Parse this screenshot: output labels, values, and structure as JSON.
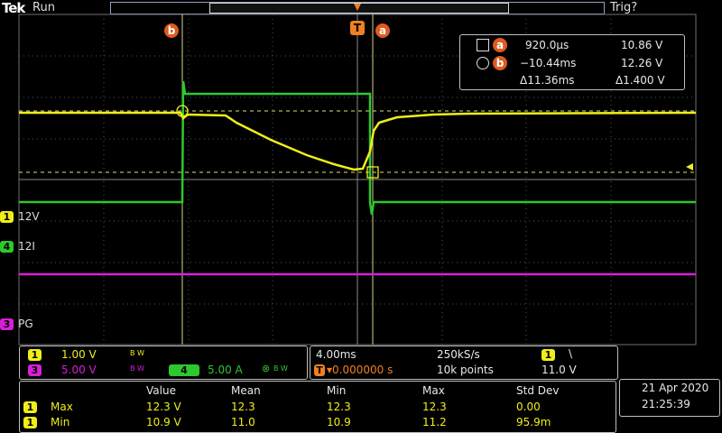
{
  "brand": "Tek",
  "run_state": "Run",
  "trigger_status": "Trig?",
  "markers": {
    "cursor_b": "b",
    "cursor_a": "a",
    "trigger": "T"
  },
  "cursor_readout": {
    "a_time": "920.0µs",
    "a_volt": "10.86 V",
    "b_time": "−10.44ms",
    "b_volt": "12.26 V",
    "delta_time": "Δ11.36ms",
    "delta_volt": "Δ1.400 V",
    "a_label": "a",
    "b_label": "b"
  },
  "channels": [
    {
      "num": "1",
      "name": "12V",
      "scale": "1.00 V",
      "bw": "B W",
      "color": "#f0ee1a"
    },
    {
      "num": "4",
      "name": "12I",
      "scale": "5.00 A",
      "bw": "B W",
      "color": "#2ec82e"
    },
    {
      "num": "3",
      "name": "PG",
      "scale": "5.00 V",
      "bw": "B W",
      "color": "#d81fd8"
    }
  ],
  "timebase": {
    "scale": "4.00ms",
    "sample_rate": "250kS/s",
    "trig_pos": "▾0.000000 s",
    "record": "10k points",
    "trig_ch": "1",
    "trig_slope": "\\",
    "trig_level": "11.0 V"
  },
  "measurements": {
    "headers": [
      "Value",
      "Mean",
      "Min",
      "Max",
      "Std Dev"
    ],
    "rows": [
      {
        "ch": "1",
        "type": "Max",
        "value": "12.3 V",
        "mean": "12.3",
        "min": "12.3",
        "max": "12.3",
        "std": "0.00"
      },
      {
        "ch": "1",
        "type": "Min",
        "value": "10.9 V",
        "mean": "11.0",
        "min": "10.9",
        "max": "11.2",
        "std": "95.9m"
      }
    ]
  },
  "datetime": {
    "date": "21 Apr  2020",
    "time": "21:25:39"
  },
  "colors": {
    "ch1": "#f0ee1a",
    "ch4": "#2ec82e",
    "ch3": "#d81fd8",
    "cursor": "#e05a1e"
  }
}
